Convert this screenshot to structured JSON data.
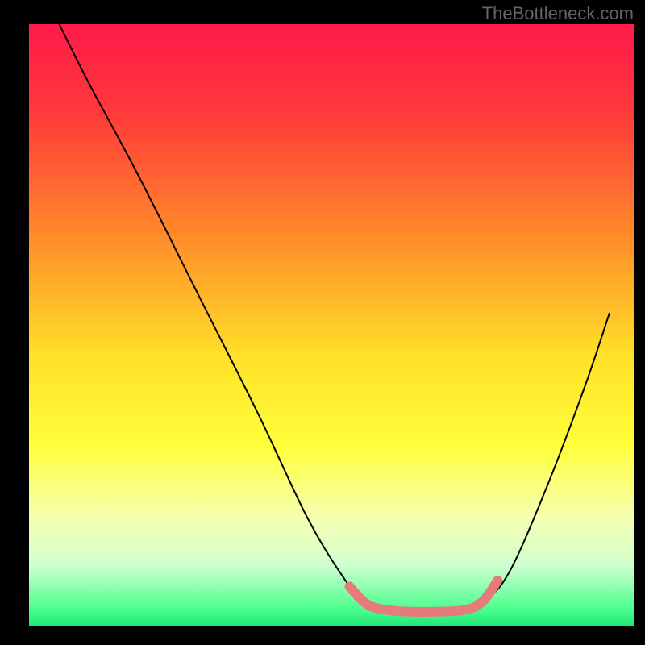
{
  "watermark": "TheBottleneck.com",
  "chart_data": {
    "type": "line",
    "title": "",
    "xlabel": "",
    "ylabel": "",
    "x_range": [
      0,
      100
    ],
    "y_range": [
      0,
      100
    ],
    "background_gradient": {
      "stops": [
        {
          "pos": 0.0,
          "color": "#ff1a4a"
        },
        {
          "pos": 0.15,
          "color": "#ff3a3a"
        },
        {
          "pos": 0.35,
          "color": "#ff8a2a"
        },
        {
          "pos": 0.55,
          "color": "#ffe028"
        },
        {
          "pos": 0.7,
          "color": "#ffff3a"
        },
        {
          "pos": 0.82,
          "color": "#f5ffb0"
        },
        {
          "pos": 0.9,
          "color": "#d0ffd0"
        },
        {
          "pos": 0.97,
          "color": "#50ff90"
        },
        {
          "pos": 1.0,
          "color": "#20e878"
        }
      ]
    },
    "series": [
      {
        "name": "bottleneck-curve",
        "stroke": "#000000",
        "stroke_width": 2,
        "points": [
          {
            "x": 5,
            "y": 100
          },
          {
            "x": 10,
            "y": 90
          },
          {
            "x": 18,
            "y": 75
          },
          {
            "x": 28,
            "y": 55
          },
          {
            "x": 38,
            "y": 35
          },
          {
            "x": 46,
            "y": 18
          },
          {
            "x": 52,
            "y": 8
          },
          {
            "x": 56,
            "y": 3.5
          },
          {
            "x": 60,
            "y": 2.5
          },
          {
            "x": 66,
            "y": 2.3
          },
          {
            "x": 72,
            "y": 2.6
          },
          {
            "x": 76,
            "y": 4.5
          },
          {
            "x": 80,
            "y": 10
          },
          {
            "x": 86,
            "y": 24
          },
          {
            "x": 92,
            "y": 40
          },
          {
            "x": 96,
            "y": 52
          }
        ]
      },
      {
        "name": "optimal-zone-highlight",
        "stroke": "#e77a7a",
        "stroke_width": 12,
        "linecap": "round",
        "points": [
          {
            "x": 53,
            "y": 6.5
          },
          {
            "x": 56,
            "y": 3.5
          },
          {
            "x": 60,
            "y": 2.5
          },
          {
            "x": 66,
            "y": 2.3
          },
          {
            "x": 72,
            "y": 2.6
          },
          {
            "x": 75,
            "y": 4.0
          },
          {
            "x": 77.5,
            "y": 7.5
          }
        ]
      }
    ],
    "frame": {
      "left_margin": 36,
      "right_margin": 14,
      "top_margin": 30,
      "bottom_margin": 24
    }
  }
}
